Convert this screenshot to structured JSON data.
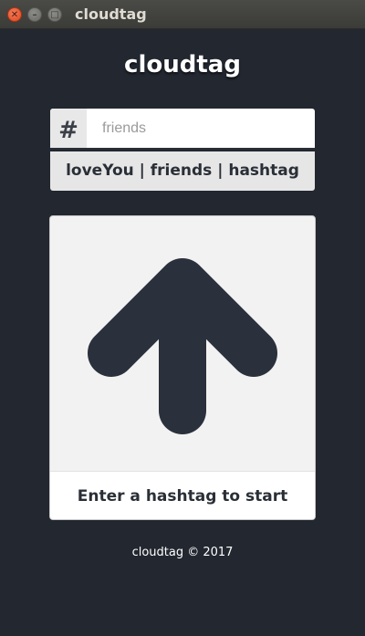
{
  "window": {
    "title": "cloudtag"
  },
  "app": {
    "title": "cloudtag"
  },
  "search": {
    "prefix": "#",
    "placeholder": "friends",
    "value": ""
  },
  "history": {
    "text": "loveYou | friends | hashtag"
  },
  "card": {
    "message": "Enter a hashtag to start",
    "icon": "arrow-up-icon"
  },
  "footer": {
    "copyright": "cloudtag © 2017"
  },
  "colors": {
    "background": "#222730",
    "arrow": "#2a313c",
    "card": "#f2f2f2"
  }
}
